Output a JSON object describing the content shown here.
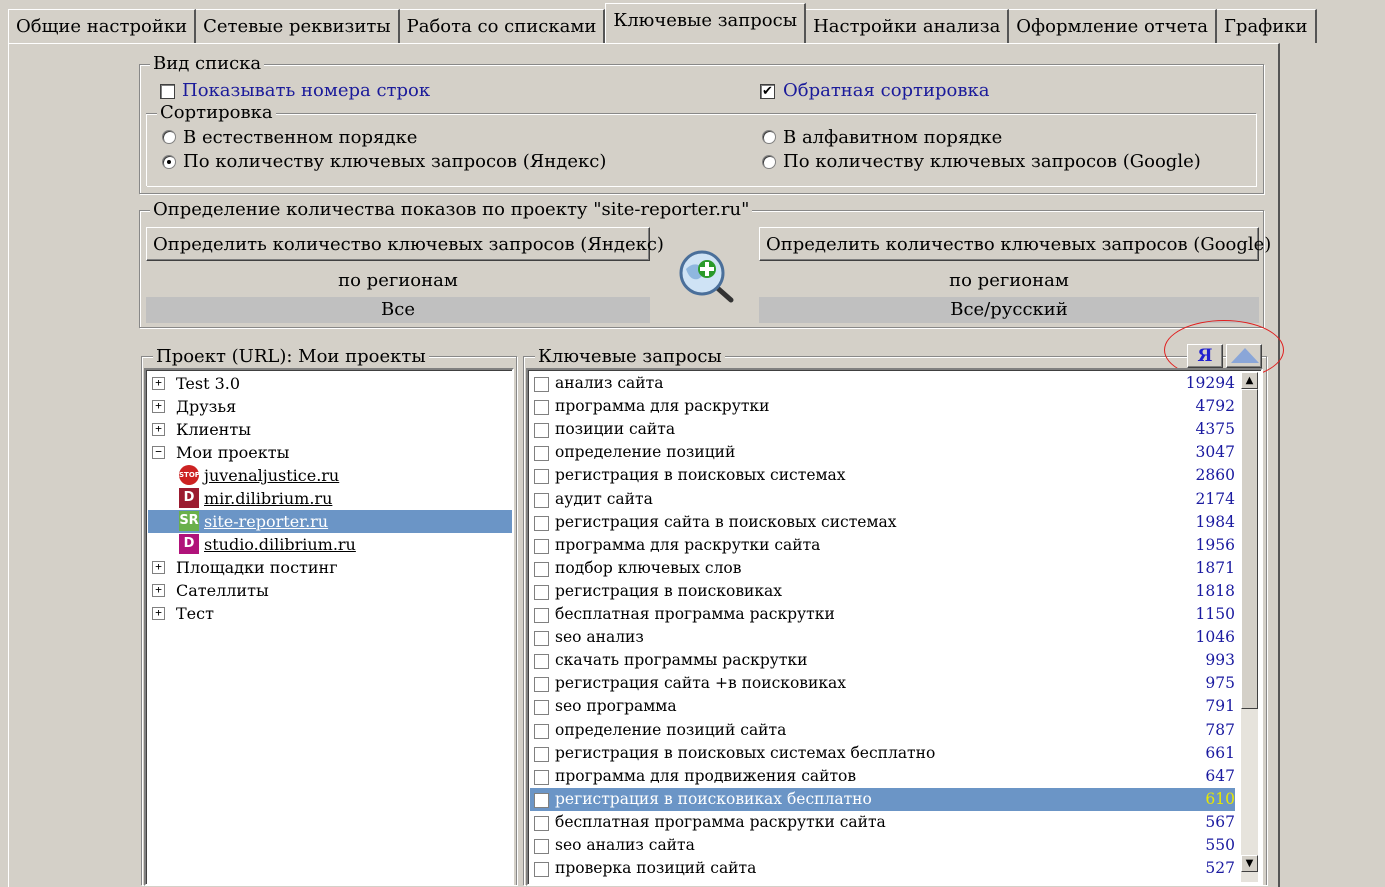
{
  "tabs": [
    "Общие настройки",
    "Сетевые реквизиты",
    "Работа со списками",
    "Ключевые запросы",
    "Настройки анализа",
    "Оформление отчета",
    "Графики"
  ],
  "list_view": {
    "legend": "Вид списка",
    "show_line_numbers": "Показывать номера строк",
    "reverse_sort": "Обратная сортировка",
    "sort_legend": "Сортировка",
    "sort_natural": "В естественном порядке",
    "sort_alpha": "В алфавитном порядке",
    "sort_yandex": "По количеству ключевых запросов (Яндекс)",
    "sort_google": "По количеству ключевых запросов (Google)"
  },
  "impressions": {
    "legend": "Определение количества показов по проекту \"site-reporter.ru\"",
    "btn_yandex": "Определить количество ключевых запросов (Яндекс)",
    "btn_google": "Определить количество ключевых запросов (Google)",
    "by_regions_left": "по регионам",
    "by_regions_right": "по регионам",
    "region_yandex": "Все",
    "region_google": "Все/русский"
  },
  "projects": {
    "legend": "Проект (URL): Мои проекты",
    "items": [
      {
        "label": "Test 3.0",
        "type": "folder",
        "exp": "+"
      },
      {
        "label": "Друзья",
        "type": "folder",
        "exp": "+"
      },
      {
        "label": "Клиенты",
        "type": "folder",
        "exp": "+"
      },
      {
        "label": "Мои проекты",
        "type": "folder",
        "exp": "−"
      },
      {
        "label": "juvenaljustice.ru",
        "type": "site",
        "icon": "stop-icon",
        "icon_text": "STOP",
        "color": "#cc2222"
      },
      {
        "label": "mir.dilibrium.ru",
        "type": "site",
        "icon": "dilibrium-icon",
        "icon_text": "D",
        "color": "#9b1b30"
      },
      {
        "label": "site-reporter.ru",
        "type": "site",
        "icon": "site-reporter-icon",
        "icon_text": "SR",
        "color": "#6ab04c"
      },
      {
        "label": "studio.dilibrium.ru",
        "type": "site",
        "icon": "studio-icon",
        "icon_text": "D",
        "color": "#b0127a"
      },
      {
        "label": "Площадки постинг",
        "type": "folder",
        "exp": "+"
      },
      {
        "label": "Сателлиты",
        "type": "folder",
        "exp": "+"
      },
      {
        "label": "Тест",
        "type": "folder",
        "exp": "+"
      }
    ],
    "selected_index": 6
  },
  "keywords": {
    "legend": "Ключевые запросы",
    "yandex_button": "Я",
    "selected_index": 18,
    "rows": [
      {
        "text": "анализ сайта",
        "count": "19294"
      },
      {
        "text": "программа для раскрутки",
        "count": "4792"
      },
      {
        "text": "позиции сайта",
        "count": "4375"
      },
      {
        "text": "определение позиций",
        "count": "3047"
      },
      {
        "text": "регистрация в поисковых системах",
        "count": "2860"
      },
      {
        "text": "аудит сайта",
        "count": "2174"
      },
      {
        "text": "регистрация сайта в поисковых системах",
        "count": "1984"
      },
      {
        "text": "программа для раскрутки сайта",
        "count": "1956"
      },
      {
        "text": "подбор ключевых слов",
        "count": "1871"
      },
      {
        "text": "регистрация в поисковиках",
        "count": "1818"
      },
      {
        "text": "бесплатная программа раскрутки",
        "count": "1150"
      },
      {
        "text": "seo анализ",
        "count": "1046"
      },
      {
        "text": "скачать программы раскрутки",
        "count": "993"
      },
      {
        "text": "регистрация сайта +в поисковиках",
        "count": "975"
      },
      {
        "text": "seo программа",
        "count": "791"
      },
      {
        "text": "определение позиций сайта",
        "count": "787"
      },
      {
        "text": "регистрация в поисковых системах бесплатно",
        "count": "661"
      },
      {
        "text": "программа для продвижения сайтов",
        "count": "647"
      },
      {
        "text": "регистрация в поисковиках бесплатно",
        "count": "610"
      },
      {
        "text": "бесплатная программа раскрутки сайта",
        "count": "567"
      },
      {
        "text": "seo анализ сайта",
        "count": "550"
      },
      {
        "text": "проверка позиций сайта",
        "count": "527"
      }
    ]
  },
  "colors": {
    "window_bg": "#d4d0c8",
    "selection": "#6b95c6",
    "link_blue": "#1a1a9a",
    "count_blue": "#1a1aa0",
    "highlight_circle": "#e02020"
  }
}
